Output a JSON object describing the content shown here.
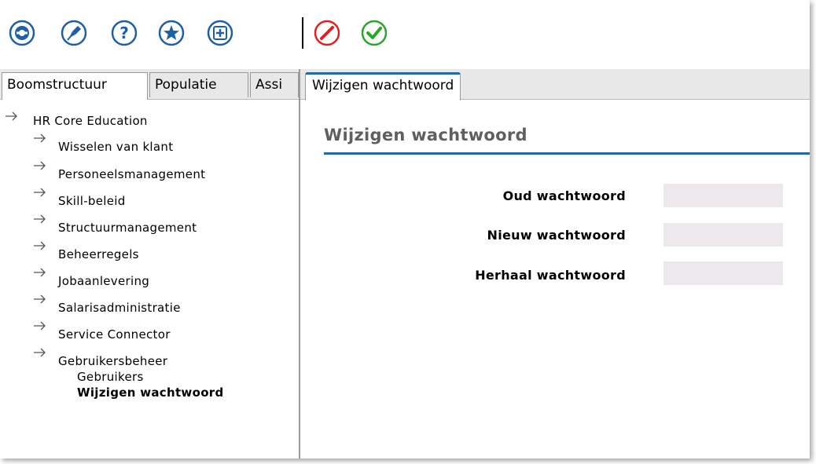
{
  "toolbar": {
    "icons": [
      "settings-icon",
      "pin-icon",
      "help-icon",
      "favorite-icon",
      "add-icon",
      "cancel-icon",
      "confirm-icon"
    ],
    "colors": {
      "blue": "#1f5fa8",
      "red": "#e02020",
      "green": "#2aa52a"
    }
  },
  "left_tabs": {
    "items": [
      {
        "label": "Boomstructuur"
      },
      {
        "label": "Populatie"
      },
      {
        "label": "Assi"
      }
    ]
  },
  "tree": {
    "root": "HR Core Education",
    "items": [
      {
        "label": "Wisselen van klant"
      },
      {
        "label": "Personeelsmanagement"
      },
      {
        "label": "Skill-beleid"
      },
      {
        "label": "Structuurmanagement"
      },
      {
        "label": "Beheerregels"
      },
      {
        "label": "Jobaanlevering"
      },
      {
        "label": "Salarisadministratie"
      },
      {
        "label": "Service Connector"
      },
      {
        "label": "Gebruikersbeheer"
      }
    ],
    "sub_items": [
      {
        "label": "Gebruikers"
      },
      {
        "label": "Wijzigen wachtwoord"
      }
    ]
  },
  "right_tab": {
    "label": "Wijzigen wachtwoord"
  },
  "page": {
    "title": "Wijzigen wachtwoord",
    "accent": "#1f6ba8"
  },
  "form": {
    "fields": [
      {
        "label": "Oud wachtwoord",
        "value": ""
      },
      {
        "label": "Nieuw wachtwoord",
        "value": ""
      },
      {
        "label": "Herhaal wachtwoord",
        "value": ""
      }
    ]
  }
}
